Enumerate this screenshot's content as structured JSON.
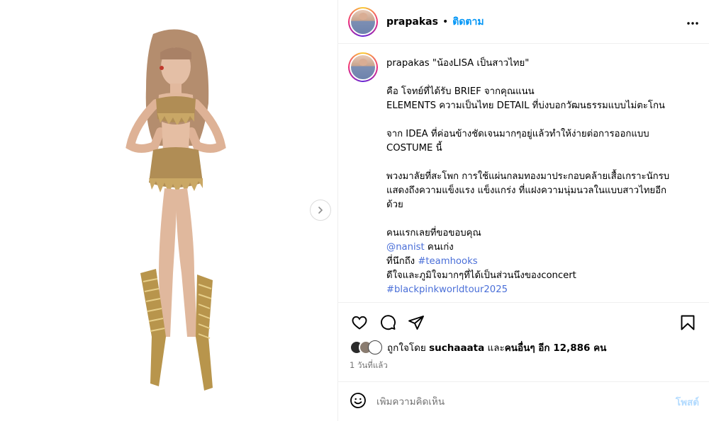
{
  "header": {
    "username": "prapakas",
    "separator": "•",
    "follow_label": "ติดตาม",
    "more_icon": "more-horizontal-icon"
  },
  "caption": {
    "username": "prapakas",
    "title": "\"น้องLISA เป็นสาวไทย\"",
    "lines": [
      "คือ โจทย์ที่ได้รับ BRIEF จากคุณแนน",
      "ELEMENTS ความเป็นไทย DETAIL ที่บ่งบอกวัฒนธรรมแบบไม่ตะโกน",
      "",
      "จาก IDEA ที่ค่อนข้างชัดเจนมากๆอยู่แล้วทำให้ง่ายต่อการออกแบบ",
      "COSTUME นี้",
      "",
      "พวงมาลัยที่สะโพก การใช้แผ่นกลมทองมาประกอบคล้ายเสื้อเกราะนักรบ",
      "แสดงถึงความแข็งแรง แข็งแกร่ง ที่แฝงความนุ่มนวลในแบบสาวไทยอีก",
      "ด้วย",
      "",
      "คนแรกเลยที่ขอขอบคุณ"
    ],
    "mention": "@nanist",
    "mention_suffix": " คนเก่ง",
    "hook_prefix": "ที่นึกถึง ",
    "hook_tag": "#teamhooks",
    "happy_line": "ดีใจและภูมิใจมากๆที่ได้เป็นส่วนนึงของconcert",
    "tour_tag": "#blackpinkworldtour2025"
  },
  "actions": {
    "like_icon": "heart-icon",
    "comment_icon": "comment-icon",
    "share_icon": "share-icon",
    "save_icon": "bookmark-icon"
  },
  "likes": {
    "prefix": "ถูกใจโดย ",
    "user": "suchaaata",
    "middle": " และ",
    "others": "คนอื่นๆ อีก 12,886 คน"
  },
  "timestamp": "1 วันที่แล้ว",
  "comment_box": {
    "emoji_icon": "emoji-icon",
    "placeholder": "เพิ่มความคิดเห็น",
    "post_label": "โพสต์"
  },
  "media": {
    "next_icon": "chevron-right-icon"
  },
  "colors": {
    "accent": "#0095f6",
    "link": "#4a6fd8",
    "muted": "#737373",
    "post_disabled": "#b3dbff"
  }
}
